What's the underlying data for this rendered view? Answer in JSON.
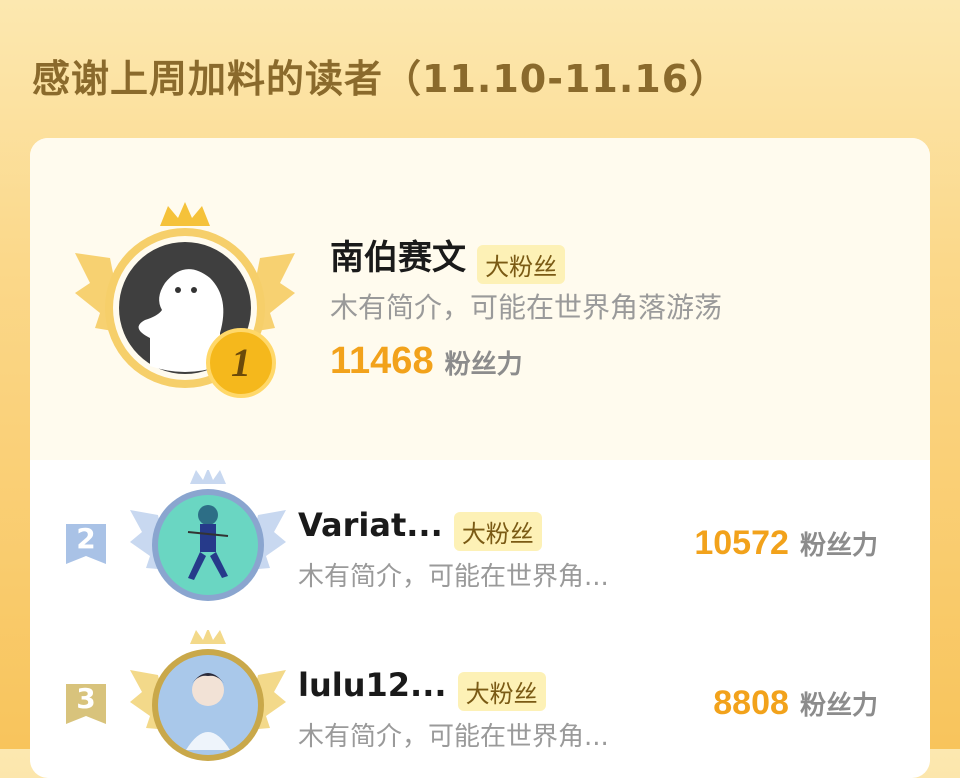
{
  "header": {
    "title": "感谢上周加料的读者（11.10-11.16）"
  },
  "colors": {
    "accent": "#f2a21b",
    "badge_bg": "#fdf1b6",
    "panel_bg": "#fffbee"
  },
  "fans": [
    {
      "rank": "1",
      "name": "南伯赛文",
      "badge": "大粉丝",
      "bio": "木有简介，可能在世界角落游荡",
      "score": "11468",
      "unit": "粉丝力",
      "avatar": "ghost-avatar-icon"
    },
    {
      "rank": "2",
      "name": "Variat...",
      "badge": "大粉丝",
      "bio": "木有简介，可能在世界角...",
      "score": "10572",
      "unit": "粉丝力",
      "avatar": "running-character-avatar"
    },
    {
      "rank": "3",
      "name": "lulu12...",
      "badge": "大粉丝",
      "bio": "木有简介，可能在世界角...",
      "score": "8808",
      "unit": "粉丝力",
      "avatar": "anime-character-avatar"
    }
  ]
}
